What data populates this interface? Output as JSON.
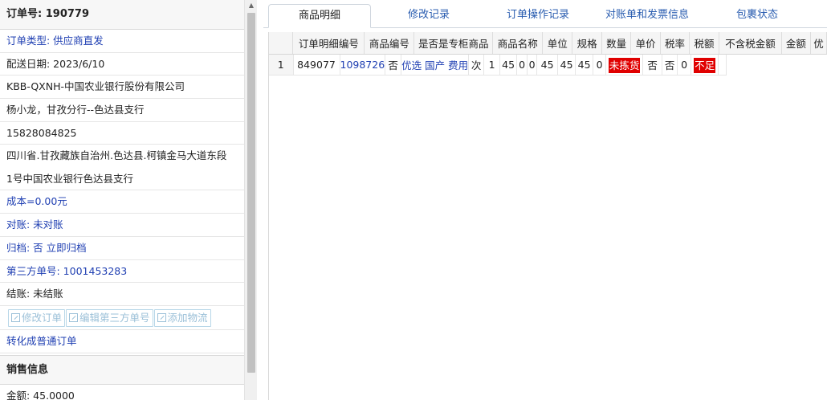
{
  "order": {
    "number_label": "订单号: 190779",
    "type_label": "订单类型: 供应商直发",
    "delivery_date": "配送日期: 2023/6/10",
    "company": "KBB-QXNH-中国农业银行股份有限公司",
    "contact": "杨小龙，甘孜分行--色达县支行",
    "phone": "15828084825",
    "address": "四川省.甘孜藏族自治州.色达县.柯镇金马大道东段1号中国农业银行色达县支行",
    "cost": "成本=0.00元",
    "reconcile": "对账: 未对账",
    "archive_prefix": "归档:  否 ",
    "archive_link": "立即归档",
    "third_party": "第三方单号: 1001453283",
    "settle": "结账: 未结账"
  },
  "actions": {
    "edit_order": "修改订单",
    "edit_third_party": "编辑第三方单号",
    "add_logistics": "添加物流",
    "convert": "转化成普通订单"
  },
  "sales": {
    "title": "销售信息",
    "amount": "金额: 45.0000"
  },
  "tabs": [
    "商品明细",
    "修改记录",
    "订单操作记录",
    "对账单和发票信息",
    "包裹状态"
  ],
  "table": {
    "headers": [
      "",
      "订单明细编号",
      "商品编号",
      "是否是专柜商品",
      "商品名称",
      "单位",
      "规格",
      "数量",
      "单价",
      "税率",
      "税额",
      "不含税金额",
      "金额",
      "优"
    ],
    "row": [
      "1",
      "849077",
      "1098726",
      "否",
      "优选 国产 费用",
      "次",
      "1",
      "45",
      "0",
      "0",
      "45",
      "45",
      "45",
      "0",
      "未拣货",
      "否",
      "否",
      "0",
      "不足",
      ""
    ]
  },
  "colors": {
    "link": "#1f3fb2",
    "tab_link": "#2a5db0",
    "alert_red": "#e00000"
  }
}
